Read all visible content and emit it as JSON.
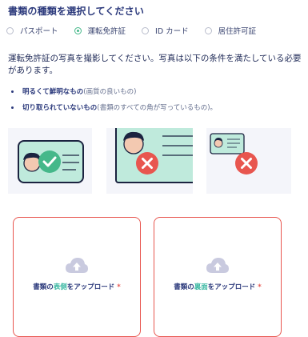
{
  "heading": "書類の種類を選択してください",
  "document_types": [
    {
      "label": "パスポート",
      "selected": false
    },
    {
      "label": "運転免許証",
      "selected": true
    },
    {
      "label": "ID カード",
      "selected": false
    },
    {
      "label": "居住許可証",
      "selected": false
    }
  ],
  "instruction": "運転免許証の写真を撮影してください。写真は以下の条件を満たしている必要があります。",
  "conditions": [
    {
      "strong": "明るくて鮮明なもの",
      "note": " (画質の良いもの)"
    },
    {
      "strong": "切り取られていないもの",
      "note": " (書類のすべての角が写っているもの)。"
    }
  ],
  "examples": [
    {
      "status": "good",
      "icon": "check-icon"
    },
    {
      "status": "bad",
      "icon": "close-icon"
    },
    {
      "status": "bad",
      "icon": "close-icon"
    }
  ],
  "uploads": {
    "front": {
      "prefix": "書類の",
      "accent": "表側",
      "suffix": "をアップロード",
      "required": "*"
    },
    "back": {
      "prefix": "書類の",
      "accent": "裏面",
      "suffix": "をアップロード",
      "required": "*"
    }
  },
  "colors": {
    "accent_green": "#45b88a",
    "error_red": "#e8564f",
    "heading_navy": "#2c3a7c",
    "card_mint": "#bfeadc"
  }
}
